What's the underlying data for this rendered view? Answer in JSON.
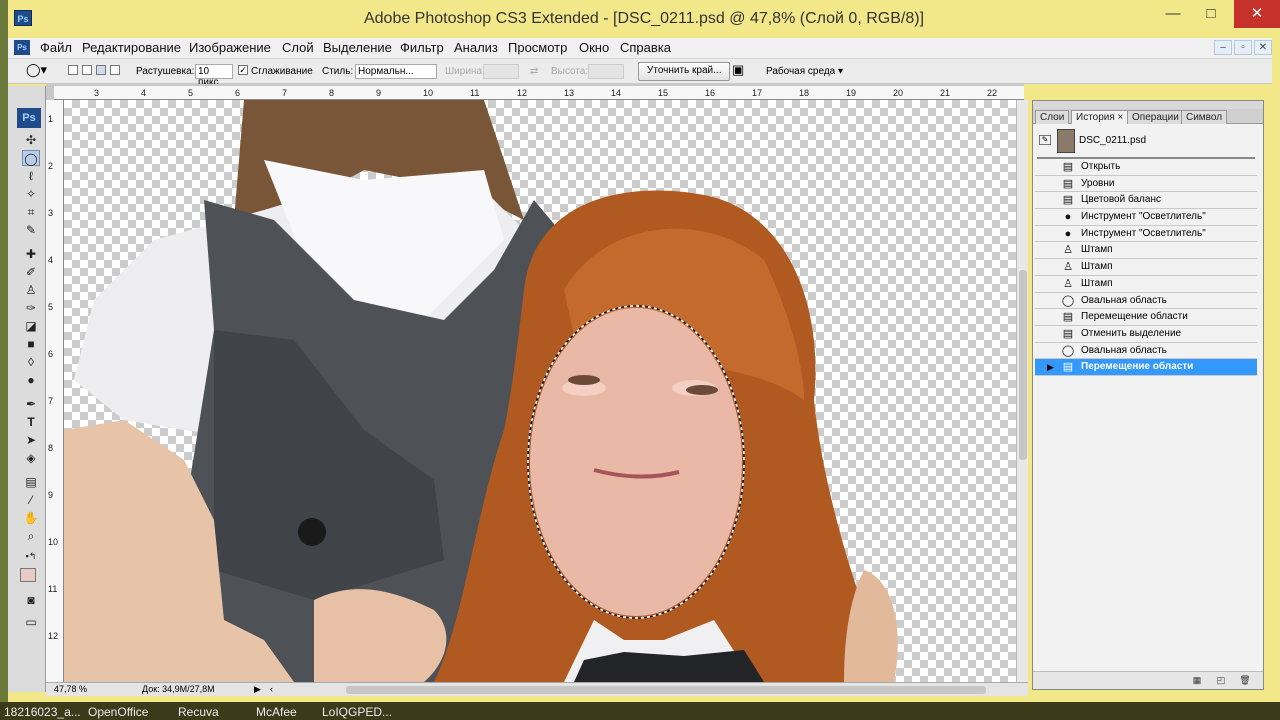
{
  "window": {
    "title": "Adobe Photoshop CS3 Extended - [DSC_0211.psd @ 47,8% (Слой 0, RGB/8)]",
    "app_icon": "Ps",
    "min": "—",
    "max": "□",
    "close": "✕"
  },
  "menu": [
    "Файл",
    "Редактирование",
    "Изображение",
    "Слой",
    "Выделение",
    "Фильтр",
    "Анализ",
    "Просмотр",
    "Окно",
    "Справка"
  ],
  "options": {
    "feather_label": "Растушевка:",
    "feather_value": "10 пикс",
    "antialias_label": "Сглаживание",
    "style_label": "Стиль:",
    "style_value": "Нормальн...",
    "width_label": "Ширина:",
    "height_label": "Высота:",
    "refine": "Уточнить край...",
    "workspace": "Рабочая среда ▾"
  },
  "ruler_h": [
    "3",
    "4",
    "5",
    "6",
    "7",
    "8",
    "9",
    "10",
    "11",
    "12",
    "13",
    "14",
    "15",
    "16",
    "17",
    "18",
    "19",
    "20",
    "21",
    "22"
  ],
  "ruler_v": [
    "1",
    "2",
    "3",
    "4",
    "5",
    "6",
    "7",
    "8",
    "9",
    "10",
    "11",
    "12"
  ],
  "status": {
    "zoom": "47,78 %",
    "doc": "Док: 34,9M/27,8M"
  },
  "panel": {
    "tabs": [
      "Слои",
      "История ×",
      "Операции",
      "Символ"
    ],
    "snapshot": "DSC_0211.psd",
    "history": [
      {
        "icon": "doc-icon",
        "glyph": "▤",
        "label": "Открыть"
      },
      {
        "icon": "doc-icon",
        "glyph": "▤",
        "label": "Уровни"
      },
      {
        "icon": "doc-icon",
        "glyph": "▤",
        "label": "Цветовой баланс"
      },
      {
        "icon": "dodge-icon",
        "glyph": "●",
        "label": "Инструмент \"Осветлитель\""
      },
      {
        "icon": "dodge-icon",
        "glyph": "●",
        "label": "Инструмент \"Осветлитель\""
      },
      {
        "icon": "stamp-icon",
        "glyph": "♙",
        "label": "Штамп"
      },
      {
        "icon": "stamp-icon",
        "glyph": "♙",
        "label": "Штамп"
      },
      {
        "icon": "stamp-icon",
        "glyph": "♙",
        "label": "Штамп"
      },
      {
        "icon": "ellipse-icon",
        "glyph": "◯",
        "label": "Овальная область"
      },
      {
        "icon": "doc-icon",
        "glyph": "▤",
        "label": "Перемещение области"
      },
      {
        "icon": "doc-icon",
        "glyph": "▤",
        "label": "Отменить выделение"
      },
      {
        "icon": "ellipse-icon",
        "glyph": "◯",
        "label": "Овальная область"
      },
      {
        "icon": "doc-icon",
        "glyph": "▤",
        "label": "Перемещение области",
        "selected": true
      }
    ]
  },
  "taskbar": [
    "18216023_a...",
    "OpenOffice",
    "Recuva",
    "McAfee",
    "LoIQGPED..."
  ],
  "colors": {
    "accent": "#3399ff",
    "title_bg": "#f2e88a",
    "close": "#c7312b",
    "foreground_swatch": "#e8cbc4"
  }
}
